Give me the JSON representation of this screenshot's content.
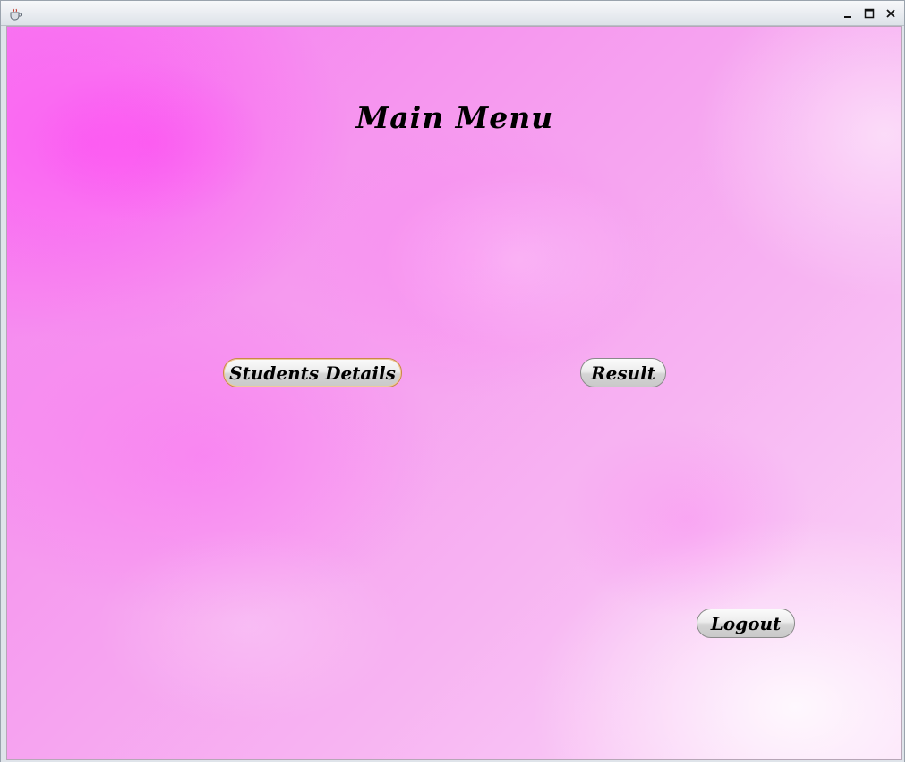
{
  "window": {
    "icon": "java-cup-icon",
    "controls": {
      "minimize": "–",
      "maximize": "□",
      "close": "✕"
    }
  },
  "main": {
    "title": "Main Menu",
    "buttons": {
      "students_details": "Students Details",
      "result": "Result",
      "logout": "Logout"
    }
  },
  "colors": {
    "background_primary": "#f77cf0",
    "background_light": "#fbd9f8",
    "button_face": "#e6e6e6",
    "focus_border": "#c98a47",
    "text": "#000000"
  }
}
